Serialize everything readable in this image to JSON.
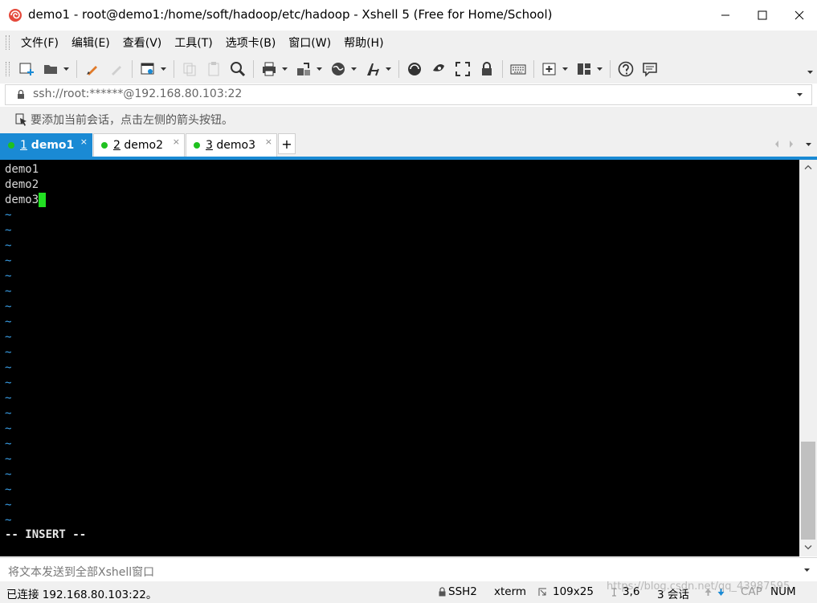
{
  "window": {
    "title": "demo1 - root@demo1:/home/soft/hadoop/etc/hadoop - Xshell 5 (Free for Home/School)"
  },
  "menu": [
    {
      "label": "文件(F)"
    },
    {
      "label": "编辑(E)"
    },
    {
      "label": "查看(V)"
    },
    {
      "label": "工具(T)"
    },
    {
      "label": "选项卡(B)"
    },
    {
      "label": "窗口(W)"
    },
    {
      "label": "帮助(H)"
    }
  ],
  "address": {
    "value": "ssh://root:******@192.168.80.103:22"
  },
  "hint": {
    "text": "要添加当前会话，点击左侧的箭头按钮。"
  },
  "tabs": [
    {
      "num": "1",
      "name": " demo1",
      "active": true
    },
    {
      "num": "2",
      "name": " demo2",
      "active": false
    },
    {
      "num": "3",
      "name": " demo3",
      "active": false
    }
  ],
  "terminal": {
    "lines": [
      "demo1",
      "demo2",
      "demo3"
    ],
    "tilde_char": "~",
    "mode": "-- INSERT --"
  },
  "sendbar": {
    "placeholder": "将文本发送到全部Xshell窗口"
  },
  "status": {
    "connection": "已连接 192.168.80.103:22。",
    "protocol": "SSH2",
    "term": "xterm",
    "size": "109x25",
    "cursor_pos": "3,6",
    "sessions": "3 会话",
    "caps": "CAP",
    "num": "NUM"
  },
  "watermark": "https://blog.csdn.net/qq_43987595",
  "colors": {
    "accent": "#1a8ad4",
    "terminal_bg": "#000000",
    "tilde": "#3aa0e8",
    "cursor": "#22e022",
    "session_dot": "#1fc11f"
  }
}
